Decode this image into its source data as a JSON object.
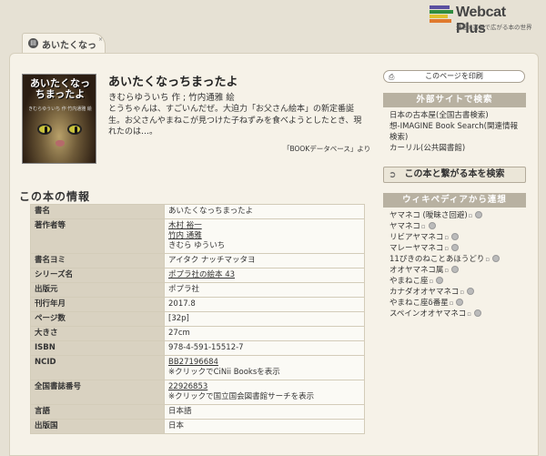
{
  "header": {
    "logo_name": "Webcat Plus",
    "logo_tagline": "連想×書棚で広がる本の世界",
    "logo_colors": [
      "#5a4fa0",
      "#2f8c3f",
      "#e0c02e",
      "#e07a2e",
      "#3a78c0"
    ],
    "tab_icon": "book-icon",
    "tab_label": "あいたくなっ",
    "tab_close": "×"
  },
  "book": {
    "cover_title": "あいたくなっちまったよ",
    "cover_sub": "きむらゆういち 作 竹内通雅 絵",
    "title": "あいたくなっちまったよ",
    "author_line": "きむらゆういち 作 ; 竹内通雅 絵",
    "description": "とうちゃんは、すごいんだぜ。大迫力「お父さん絵本」の新定番誕生。お父さんやまねこが見つけた子ねずみを食べようとしたとき、現れたのは…。",
    "description_source": "「BOOKデータベース」より"
  },
  "info": {
    "heading": "この本の情報",
    "rows": [
      {
        "key": "書名",
        "lines": [
          "あいたくなっちまったよ"
        ]
      },
      {
        "key": "著作者等",
        "lines": [
          "木村 裕一",
          "竹内 通雅",
          "きむら ゆういち"
        ],
        "linked": [
          0,
          1
        ]
      },
      {
        "key": "書名ヨミ",
        "lines": [
          "アイタク ナッチマッタヨ"
        ]
      },
      {
        "key": "シリーズ名",
        "lines": [
          "ポプラ社の絵本 43"
        ],
        "linked": [
          0
        ]
      },
      {
        "key": "出版元",
        "lines": [
          "ポプラ社"
        ]
      },
      {
        "key": "刊行年月",
        "lines": [
          "2017.8"
        ]
      },
      {
        "key": "ページ数",
        "lines": [
          "[32p]"
        ]
      },
      {
        "key": "大きさ",
        "lines": [
          "27cm"
        ]
      },
      {
        "key": "ISBN",
        "lines": [
          "978-4-591-15512-7"
        ]
      },
      {
        "key": "NCID",
        "lines": [
          "BB27196684",
          "※クリックでCiNii Booksを表示"
        ],
        "linked": [
          0
        ]
      },
      {
        "key": "全国書誌番号",
        "lines": [
          "22926853",
          "※クリックで国立国会図書館サーチを表示"
        ],
        "linked": [
          0
        ]
      },
      {
        "key": "言語",
        "lines": [
          "日本語"
        ]
      },
      {
        "key": "出版国",
        "lines": [
          "日本"
        ]
      }
    ]
  },
  "sidebar": {
    "print_label": "このページを印刷",
    "print_icon": "print-icon",
    "external_heading": "外部サイトで検索",
    "external_links": [
      "日本の古本屋(全国古書検索)",
      "想-IMAGINE Book Search(関連情報検索)",
      "カーリル(公共図書館)"
    ],
    "connect_label": "この本と繋がる本を検索",
    "connect_icon": "arrow-right-icon",
    "wiki_heading": "ウィキペディアから連想",
    "wiki_items": [
      {
        "label": "ヤマネコ (曖昧さ回避)"
      },
      {
        "label": "ヤマネコ"
      },
      {
        "label": "リビアヤマネコ"
      },
      {
        "label": "マレーヤマネコ"
      },
      {
        "label": "11ぴきのねことあほうどり"
      },
      {
        "label": "オオヤマネコ属"
      },
      {
        "label": "やまねこ座"
      },
      {
        "label": "カナダオオヤマネコ"
      },
      {
        "label": "やまねこ座δ番星"
      },
      {
        "label": "スペインオオヤマネコ"
      }
    ]
  }
}
